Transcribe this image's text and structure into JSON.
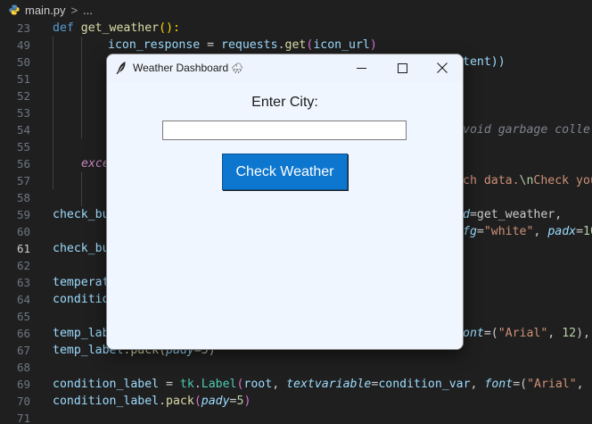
{
  "breadcrumb": {
    "file": "main.py",
    "separator": ">",
    "more": "..."
  },
  "editor": {
    "line_numbers": [
      "23",
      "49",
      "50",
      "51",
      "52",
      "53",
      "54",
      "55",
      "56",
      "57",
      "58",
      "59",
      "60",
      "61",
      "62",
      "63",
      "64",
      "65",
      "66",
      "67",
      "68",
      "69",
      "70",
      "71"
    ],
    "active_line": "61",
    "visible_code": {
      "l23_def": "def",
      "l23_fn": "get_weather",
      "l23_rest": "():",
      "l49_var": "icon_response",
      "l49_eq": " = ",
      "l49_mod": "requests",
      "l49_dot": ".",
      "l49_fn": "get",
      "l49_arg": "icon_url",
      "l50_tail": "tent))",
      "l54_tail": "void garbage colle",
      "l56_head": "exce",
      "l57_tail_a": "ch data.",
      "l57_tail_b": "\\n",
      "l57_tail_c": "Check you",
      "l59_head": "check_bu",
      "l59_tail_a": "d",
      "l59_tail_b": "=get_weather,",
      "l60_tail_a": "fg",
      "l60_tail_b": "=",
      "l60_tail_c": "\"white\"",
      "l60_tail_d": ", ",
      "l60_tail_e": "padx",
      "l60_tail_f": "=",
      "l60_tail_g": "10",
      "l60_tail_h": ",",
      "l61_head": "check_bu",
      "l63_head": "temperat",
      "l64_head": "conditio",
      "l66_head": "temp_lab",
      "l66_tail_a": "ont",
      "l66_tail_b": "=(",
      "l66_tail_c": "\"Arial\"",
      "l66_tail_d": ", ",
      "l66_tail_e": "12",
      "l66_tail_f": "), b",
      "l67_a": "temp_label",
      "l67_b": ".pack(",
      "l67_c": "pady",
      "l67_d": "=",
      "l67_e": "5",
      "l67_f": ")",
      "l69_a": "condition_label",
      "l69_b": " = ",
      "l69_c": "tk",
      "l69_d": ".",
      "l69_e": "Label",
      "l69_f": "(",
      "l69_g": "root",
      "l69_h": ", ",
      "l69_i": "textvariable",
      "l69_j": "=",
      "l69_k": "condition_var",
      "l69_l": ", ",
      "l69_m": "font",
      "l69_n": "=(",
      "l69_o": "\"Arial\"",
      "l69_p": ", ",
      "l69_q": "12",
      "l69_r": ")",
      "l70_a": "condition_label",
      "l70_b": ".",
      "l70_c": "pack",
      "l70_d": "(",
      "l70_e": "pady",
      "l70_f": "=",
      "l70_g": "5",
      "l70_h": ")"
    }
  },
  "app_window": {
    "title": "Weather Dashboard",
    "title_icon": "cloud-rain-icon",
    "title_icon_glyph": "🌧",
    "label": "Enter City:",
    "input_value": "",
    "button_label": "Check Weather",
    "colors": {
      "button_bg": "#0d77cf",
      "button_text": "#ffffff",
      "window_bg": "#f0f6ff"
    }
  }
}
